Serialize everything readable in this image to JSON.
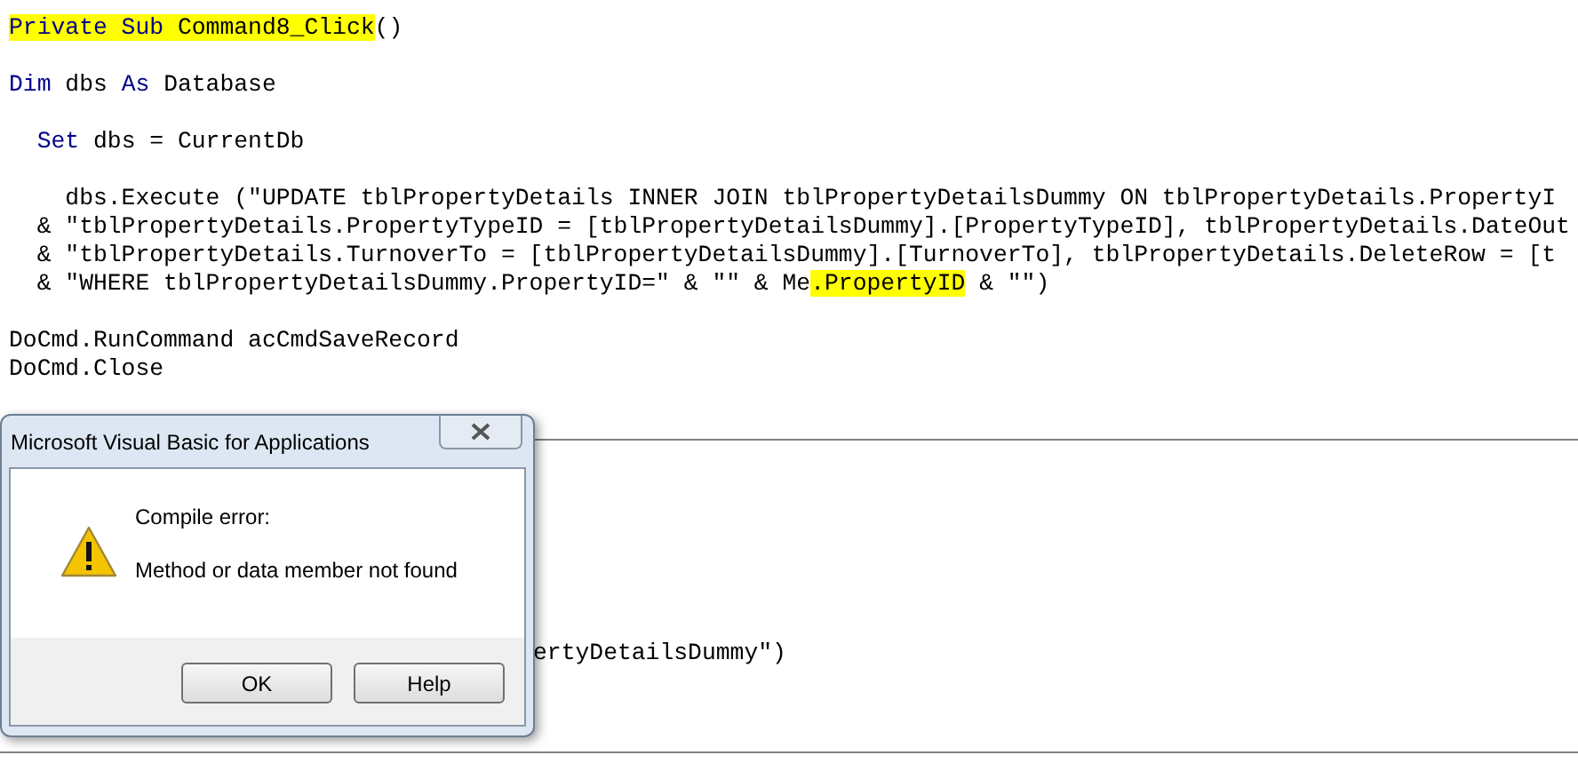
{
  "code_blocks": [
    [
      [
        {
          "text": "Private Sub",
          "kind": "keyword",
          "highlighted": true
        },
        {
          "text": " Command8_Click",
          "kind": "plain",
          "highlighted": true
        },
        {
          "text": "()",
          "kind": "plain",
          "highlighted": false
        }
      ]
    ],
    [
      [
        {
          "text": "Dim",
          "kind": "keyword",
          "highlighted": false
        },
        {
          "text": " dbs ",
          "kind": "plain",
          "highlighted": false
        },
        {
          "text": "As",
          "kind": "keyword",
          "highlighted": false
        },
        {
          "text": " Database",
          "kind": "plain",
          "highlighted": false
        }
      ]
    ],
    [
      [
        {
          "text": "  Set",
          "kind": "keyword",
          "highlighted": false
        },
        {
          "text": " dbs = CurrentDb",
          "kind": "plain",
          "highlighted": false
        }
      ]
    ],
    [
      [
        {
          "text": "    dbs.Execute (\"UPDATE tblPropertyDetails INNER JOIN tblPropertyDetailsDummy ON tblPropertyDetails.PropertyI",
          "kind": "plain",
          "highlighted": false
        }
      ],
      [
        {
          "text": "  & \"tblPropertyDetails.PropertyTypeID = [tblPropertyDetailsDummy].[PropertyTypeID], tblPropertyDetails.DateOut",
          "kind": "plain",
          "highlighted": false
        }
      ],
      [
        {
          "text": "  & \"tblPropertyDetails.TurnoverTo = [tblPropertyDetailsDummy].[TurnoverTo], tblPropertyDetails.DeleteRow = [t",
          "kind": "plain",
          "highlighted": false
        }
      ],
      [
        {
          "text": "  & \"WHERE tblPropertyDetailsDummy.PropertyID=\" & \"\" & Me",
          "kind": "plain",
          "highlighted": false
        },
        {
          "text": ".PropertyID",
          "kind": "plain",
          "highlighted": true
        },
        {
          "text": " & \"\")",
          "kind": "plain",
          "highlighted": false
        }
      ]
    ],
    [
      [
        {
          "text": "DoCmd.RunCommand acCmdSaveRecord",
          "kind": "plain",
          "highlighted": false
        }
      ],
      [
        {
          "text": "DoCmd.Close",
          "kind": "plain",
          "highlighted": false
        }
      ]
    ]
  ],
  "lower_code": [
    {
      "text": "ertyDetailsDummy\")",
      "kind": "plain"
    }
  ],
  "dialog": {
    "title": "Microsoft Visual Basic for Applications",
    "heading": "Compile error:",
    "message": "Method or data member not found",
    "buttons": [
      "OK",
      "Help"
    ]
  }
}
